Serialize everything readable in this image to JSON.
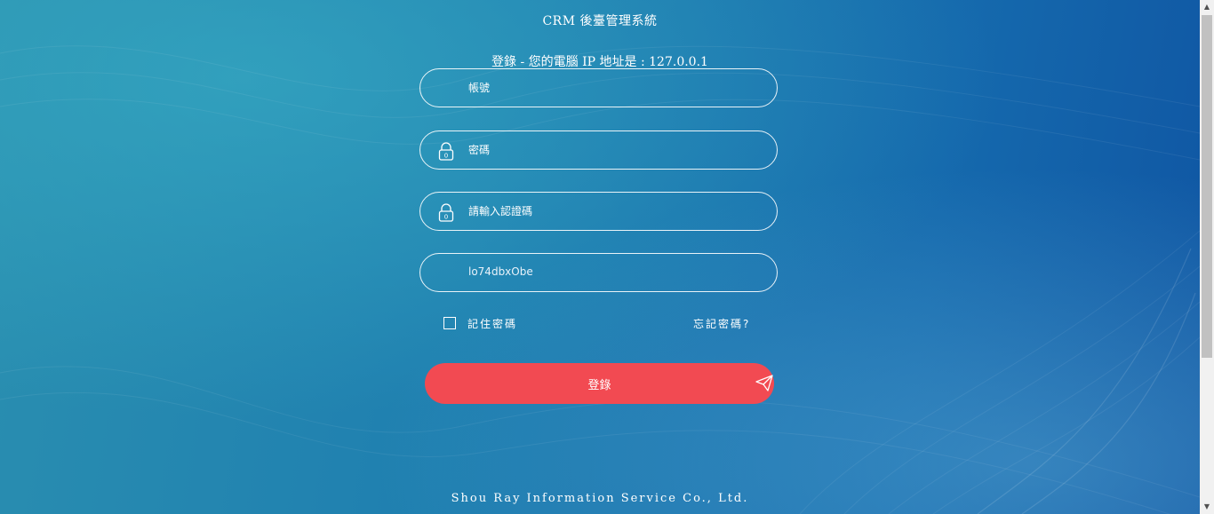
{
  "header": {
    "title": "CRM 後臺管理系統",
    "ip_line": "登錄 - 您的電腦 IP 地址是 : 127.0.0.1"
  },
  "form": {
    "account_placeholder": "帳號",
    "password_placeholder": "密碼",
    "captcha_placeholder": "請輸入認證碼",
    "captcha_code": "lo74dbxObe",
    "remember_label": "記住密碼",
    "forgot_link": "忘記密碼?",
    "login_button": "登錄",
    "lock_icon_digit": "0"
  },
  "footer": {
    "company": "Shou Ray Information Service Co., Ltd."
  },
  "icons": {
    "password": "lock-icon",
    "captcha": "lock-icon",
    "submit": "paper-plane-icon"
  },
  "colors": {
    "accent": "#f24a52",
    "background_start": "#2a8fb0",
    "background_end": "#0f54a2"
  }
}
